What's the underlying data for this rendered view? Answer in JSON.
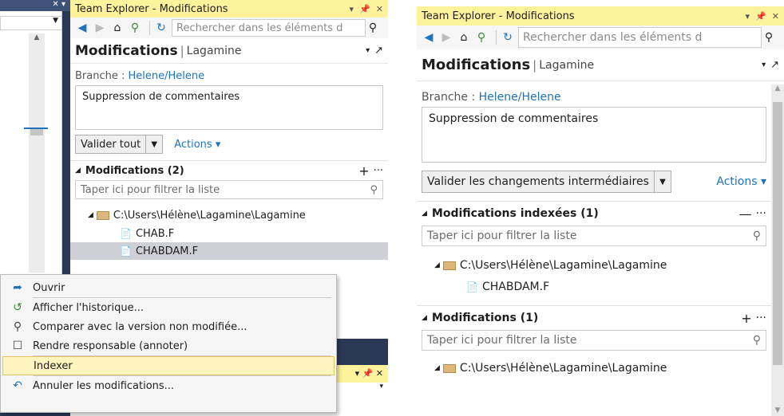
{
  "left": {
    "title": "Team Explorer - Modifications",
    "search_placeholder": "Rechercher dans les éléments d",
    "header_title": "Modifications",
    "repo": "Lagamine",
    "branch_label": "Branche :",
    "branch_value": "Helene/Helene",
    "commit_message": "Suppression de commentaires",
    "commit_button": "Valider tout",
    "actions_label": "Actions",
    "section": "Modifications (2)",
    "filter_placeholder": "Taper ici pour filtrer la liste",
    "folder_path": "C:\\Users\\Hélène\\Lagamine\\Lagamine",
    "files": [
      "CHAB.F",
      "CHABDAM.F"
    ]
  },
  "context_menu": {
    "items": [
      "Ouvrir",
      "Afficher l'historique...",
      "Comparer avec la version non modifiée...",
      "Rendre responsable (annoter)",
      "Indexer",
      "Annuler les modifications..."
    ],
    "highlighted": "Indexer"
  },
  "right": {
    "title": "Team Explorer - Modifications",
    "search_placeholder": "Rechercher dans les éléments d",
    "header_title": "Modifications",
    "repo": "Lagamine",
    "branch_label": "Branche :",
    "branch_value": "Helene/Helene",
    "commit_message": "Suppression de commentaires",
    "commit_button": "Valider les changements intermédiaires",
    "actions_label": "Actions",
    "staged_section": "Modifications indexées (1)",
    "filter_placeholder": "Taper ici pour filtrer la liste",
    "folder_path": "C:\\Users\\Hélène\\Lagamine\\Lagamine",
    "staged_file": "CHABDAM.F",
    "changes_section": "Modifications (1)",
    "filter_placeholder2": "Taper ici pour filtrer la liste",
    "folder_path2": "C:\\Users\\Hélène\\Lagamine\\Lagamine"
  },
  "colors": {
    "title_bg": "#fff29d",
    "link": "#1e73be",
    "menu_highlight": "#fdf4bf",
    "dark_panel": "#293955"
  }
}
